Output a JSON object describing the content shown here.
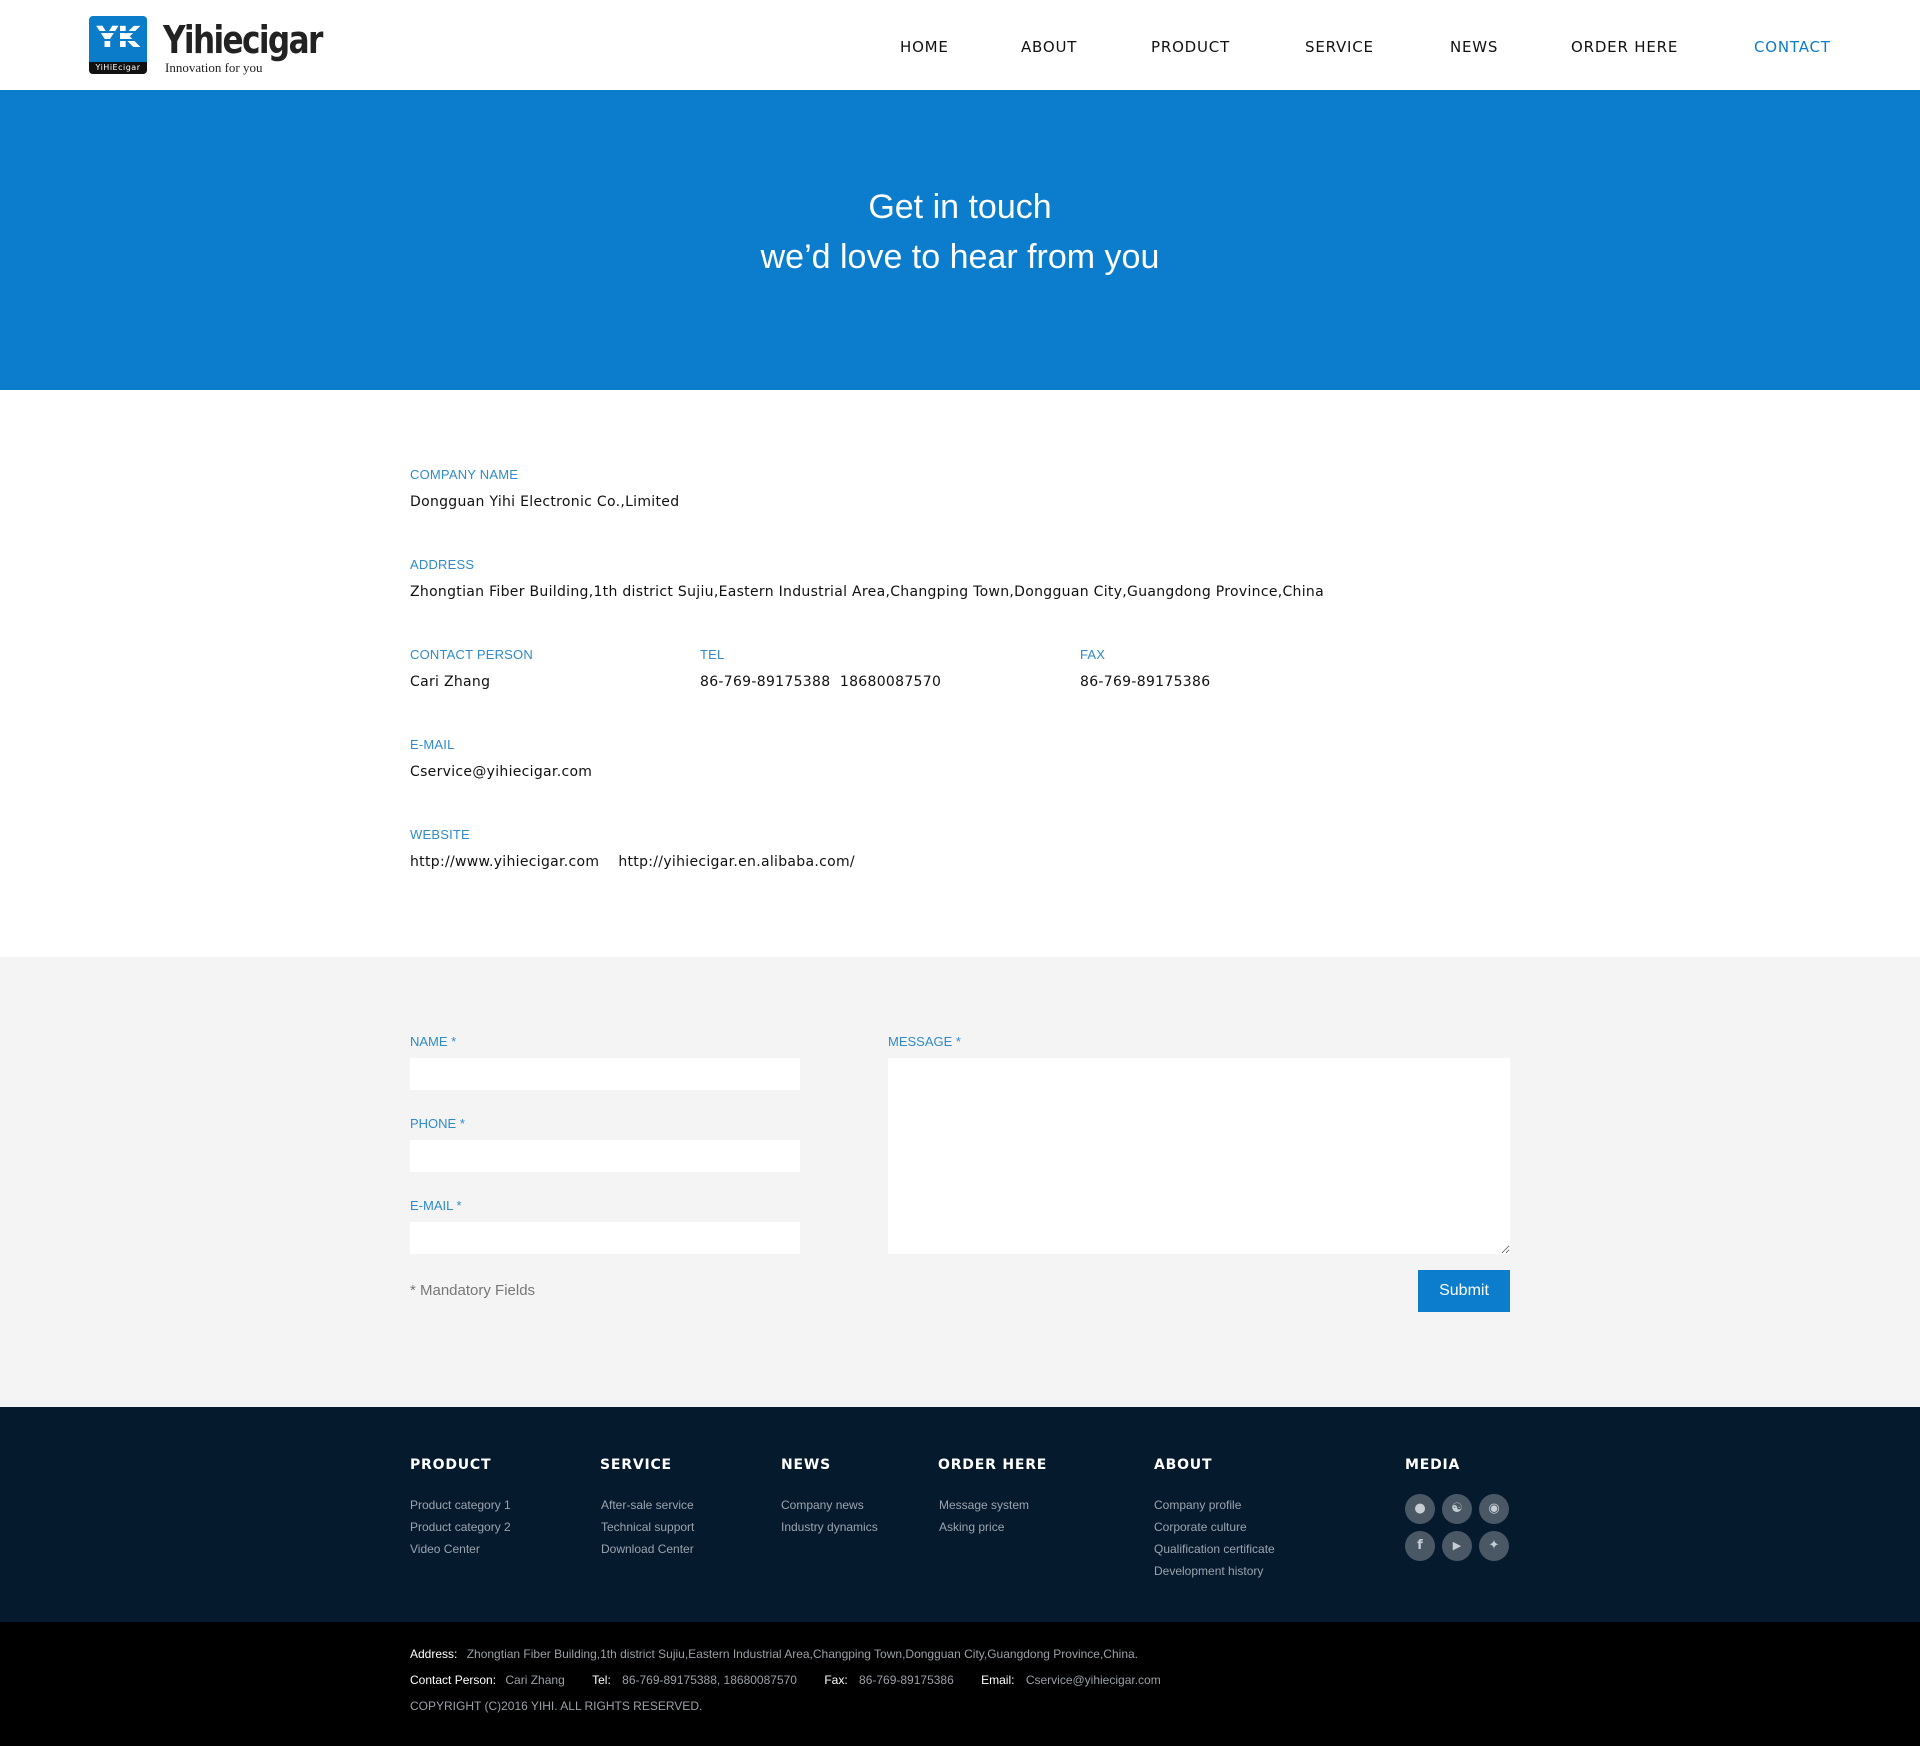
{
  "brand": {
    "logo_mark": "YK",
    "logo_small": "YiHiEcigar",
    "name": "Yihiecigar",
    "slogan": "Innovation for you"
  },
  "nav": {
    "items": [
      "HOME",
      "ABOUT",
      "PRODUCT",
      "SERVICE",
      "NEWS",
      "ORDER HERE",
      "CONTACT"
    ],
    "active": "CONTACT"
  },
  "hero": {
    "line1": "Get in touch",
    "line2": "we’d love to hear from you"
  },
  "info": {
    "company_label": "COMPANY NAME",
    "company_value": "Dongguan Yihi Electronic Co.,Limited",
    "address_label": "ADDRESS",
    "address_value": "Zhongtian Fiber Building,1th district Sujiu,Eastern Industrial Area,Changping Town,Dongguan City,Guangdong Province,China",
    "contact_label": "CONTACT PERSON",
    "contact_value": "Cari Zhang",
    "tel_label": "TEL",
    "tel_value": "86-769-89175388  18680087570",
    "fax_label": "FAX",
    "fax_value": "86-769-89175386",
    "email_label": "E-MAIL",
    "email_value": "Cservice@yihiecigar.com",
    "website_label": "WEBSITE",
    "website_value": "http://www.yihiecigar.com    http://yihiecigar.en.alibaba.com/"
  },
  "form": {
    "name_label": "NAME *",
    "name_value": "",
    "phone_label": "PHONE *",
    "phone_value": "",
    "email_label": "E-MAIL *",
    "email_value": "",
    "message_label": "MESSAGE *",
    "message_value": "",
    "mandatory_note": "* Mandatory Fields",
    "submit_label": "Submit"
  },
  "footer": {
    "columns": [
      {
        "title": "PRODUCT",
        "links": [
          "Product category 1",
          "Product category 2",
          "Video Center"
        ]
      },
      {
        "title": "SERVICE",
        "links": [
          "After-sale service",
          "Technical support",
          "Download Center"
        ]
      },
      {
        "title": "NEWS",
        "links": [
          "Company news",
          "Industry dynamics"
        ]
      },
      {
        "title": "ORDER HERE",
        "links": [
          "Message system",
          "Asking price"
        ]
      },
      {
        "title": "ABOUT",
        "links": [
          "Company profile",
          "Corporate culture",
          "Qualification certificate",
          "Development history"
        ]
      }
    ],
    "media_title": "MEDIA",
    "media_icons": [
      "qq-icon",
      "wechat-icon",
      "weibo-icon",
      "facebook-icon",
      "youtube-icon",
      "twitter-icon"
    ]
  },
  "bottom": {
    "address_key": "Address:",
    "address_val": "Zhongtian Fiber Building,1th district Sujiu,Eastern Industrial Area,Changping Town,Dongguan City,Guangdong Province,China.",
    "contact_key": "Contact Person:",
    "contact_val": "Cari Zhang",
    "tel_key": "Tel:",
    "tel_val": "86-769-89175388, 18680087570",
    "fax_key": "Fax:",
    "fax_val": "86-769-89175386",
    "email_key": "Email:",
    "email_val": "Cservice@yihiecigar.com",
    "copyright": "COPYRIGHT (C)2016 YIHI. ALL RIGHTS RESERVED."
  },
  "colors": {
    "accent": "#0b7dcc",
    "label_blue": "#2f8bc9",
    "footer_bg": "#061a2e",
    "bottom_bg": "#000000",
    "form_bg": "#f5f4f4"
  }
}
